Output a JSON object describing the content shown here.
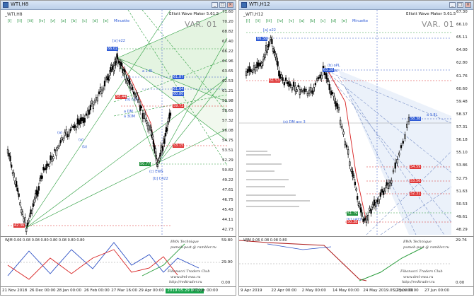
{
  "colors": {
    "green_line": "#2a9d3c",
    "red_line": "#d82222",
    "blue_line": "#2b4fc4",
    "label_red": "#e03a3a",
    "label_blue": "#2f5bd6",
    "label_green": "#1f8f3a",
    "axis": "#777777"
  },
  "left": {
    "title": "WTI,H8",
    "chart_name": "_WTI,H8",
    "ewm": "Elliott Wave Maker 5.61.5",
    "var_label": "VAR. 01",
    "cycles": [
      "[i]",
      "[ii]",
      "[iii]",
      "[iv]",
      "[v]",
      "[a]",
      "[b]",
      "[c]",
      "[d]",
      "[e]"
    ],
    "cycle_extra": "Minuette",
    "price_axis": [
      "71.60",
      "70.20",
      "68.82",
      "67.40",
      "66.22",
      "64.96",
      "63.65",
      "62.53",
      "61.21",
      "59.98",
      "58.65",
      "57.32",
      "56.08",
      "54.75",
      "53.51",
      "52.29",
      "50.82",
      "49.22",
      "47.61",
      "46.75",
      "45.43",
      "44.11",
      "42.73"
    ],
    "price_boxes": [
      {
        "text": "66.02",
        "color": "blue"
      },
      {
        "text": "61.87",
        "color": "blue"
      },
      {
        "text": "61.64",
        "color": "blue"
      },
      {
        "text": "60.80",
        "color": "blue"
      },
      {
        "text": "59.73",
        "color": "red"
      },
      {
        "text": "58.44",
        "color": "red"
      },
      {
        "text": "53.15",
        "color": "red"
      },
      {
        "text": "50.77",
        "color": "green"
      },
      {
        "text": "42.36",
        "color": "red"
      }
    ],
    "wave_labels": [
      "[a] e22",
      "[b] c22",
      "(a)",
      "(b)",
      "(c)",
      "(c) EWS",
      "a DM",
      "a 3DM",
      "a 1.8L",
      "[b] IM"
    ],
    "subwin_header": "WJM 0.06 0.08 0.08 0.80 0.80 0.08 0.80 0.80",
    "subwin_axis": [
      "59.80",
      "29.90",
      "0.00"
    ],
    "credits": [
      "Fibonacci Traders Club",
      "www.dml-ewa.ru",
      "pumeb-post @ rambler.ru",
      "http://redtrader.ru"
    ],
    "credit_header": "EWA Technique",
    "time_axis": [
      "21 Nov 2018",
      "26 Dec 00:00",
      "28 Jan 00:00",
      "26 Feb 00:00",
      "27 Mar 16:00",
      "29 Apr 00:00",
      "2019.05.29 00:00",
      "27 Jun 00:00"
    ],
    "active_time": "2019.05.29 00:00"
  },
  "right": {
    "title": "WTI,H12",
    "chart_name": "_WTI,H12",
    "ewm": "Elliott Wave Maker 5.61.5",
    "var_label": "VAR. 01",
    "cycles": [
      "[i]",
      "[ii]",
      "[iii]",
      "[iv]",
      "[v]",
      "[a]",
      "[b]",
      "[c]",
      "[d]",
      "[e]"
    ],
    "cycle_extra": "Minuette",
    "price_axis": [
      "67.30",
      "66.10",
      "65.11",
      "64.00",
      "62.80",
      "61.76",
      "60.60",
      "59.48",
      "58.37",
      "57.31",
      "56.18",
      "55.10",
      "53.86",
      "52.75",
      "51.63",
      "50.53",
      "49.61",
      "48.29"
    ],
    "price_boxes": [
      {
        "text": "66.58",
        "color": "blue"
      },
      {
        "text": "63.28",
        "color": "blue"
      },
      {
        "text": "61.53",
        "color": "red"
      },
      {
        "text": "58.38",
        "color": "blue"
      },
      {
        "text": "54.59",
        "color": "red"
      },
      {
        "text": "53.56",
        "color": "red"
      },
      {
        "text": "52.31",
        "color": "red"
      },
      {
        "text": "51.79",
        "color": "green"
      },
      {
        "text": "50.38",
        "color": "red"
      }
    ],
    "wave_labels": [
      "[a] e22",
      "[b] c22",
      "(b) oPL",
      "[b] IM",
      "(a) DM acc 3",
      "[b] c422",
      "a 1.8L"
    ],
    "subwin_header": "WJM 0.06 0.08 0.08 0.80",
    "subwin_axis": [
      "29.76",
      "0.00"
    ],
    "credits": [
      "Fibonacci Traders Club",
      "www.dml-ewa.ru",
      "pumeb-post @ rambler.ru",
      "http://redtrader.ru"
    ],
    "credit_header": "EWA Technique",
    "time_axis": [
      "9 Apr 2019",
      "22 Apr 00:00",
      "2 May 00:00",
      "14 May 00:00",
      "24 May 2019.05.28 00:00",
      "17 Jun 00:00",
      "27 Jun 00:00"
    ],
    "active_time": "2019.05.28 00:00"
  }
}
